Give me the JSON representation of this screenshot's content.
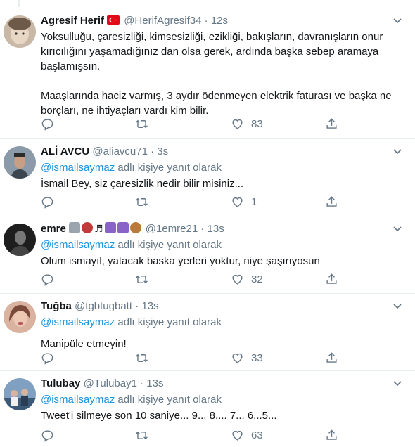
{
  "tweets": [
    {
      "name": "Agresif Herif",
      "handle": "@HerifAgresif34",
      "time": "12s",
      "has_flag": true,
      "reply_to": null,
      "text_paragraphs": [
        "Yoksulluğu, çaresizliği, kimsesizliği, ezikliği, bakışların, davranışların onur kırıcılığını yaşamadığınız dan olsa gerek, ardında başka sebep aramaya başlamışsın.",
        "Maaşlarında haciz varmış, 3 aydır ödenmeyen elektrik faturası ve başka ne borçları, ne ihtiyaçları vardı kim bilir."
      ],
      "like_count": "83",
      "avatar_colors": [
        "#c9b8a6",
        "#6e5a48"
      ]
    },
    {
      "name": "ALİ AVCU",
      "handle": "@aliavcu71",
      "time": "3s",
      "reply_prefix": "@ismailsaymaz",
      "reply_suffix": " adlı kişiye yanıt olarak",
      "text": "İsmail Bey, siz çaresizlik nedir bilir misiniz...",
      "like_count": "1",
      "avatar_colors": [
        "#8a9aa8",
        "#3b4650"
      ]
    },
    {
      "name": "emre",
      "name_emojis": [
        "🆚",
        "🚬",
        "♬",
        "♊",
        "⚕",
        "🦉"
      ],
      "handle": "@1emre21",
      "time": "13s",
      "reply_prefix": "@ismailsaymaz",
      "reply_suffix": " adlı kişiye yanıt olarak",
      "text": "Olum ismayıl, yatacak baska yerleri yoktur, niye şaşırıyosun",
      "like_count": "32",
      "avatar_colors": [
        "#555555",
        "#1e1e1e"
      ]
    },
    {
      "name": "Tuğba",
      "handle": "@tgbtugbatt",
      "time": "13s",
      "reply_prefix": "@ismailsaymaz",
      "reply_suffix": " adlı kişiye yanıt olarak",
      "text": "Manipüle etmeyin!",
      "like_count": "33",
      "avatar_colors": [
        "#d9b3a0",
        "#7a4b3a"
      ]
    },
    {
      "name": "Tulubay",
      "handle": "@Tulubay1",
      "time": "13s",
      "reply_prefix": "@ismailsaymaz",
      "reply_suffix": " adlı kişiye yanıt olarak",
      "text": "Tweet'i silmeye son 10 saniye... 9... 8.... 7... 6...5...",
      "like_count": "63",
      "avatar_colors": [
        "#7fa0c0",
        "#3c5a78"
      ]
    }
  ],
  "dot": "·",
  "colors": {
    "link": "#1b95e0",
    "muted": "#657786",
    "text": "#14171a",
    "divider": "#e6ecf0"
  }
}
